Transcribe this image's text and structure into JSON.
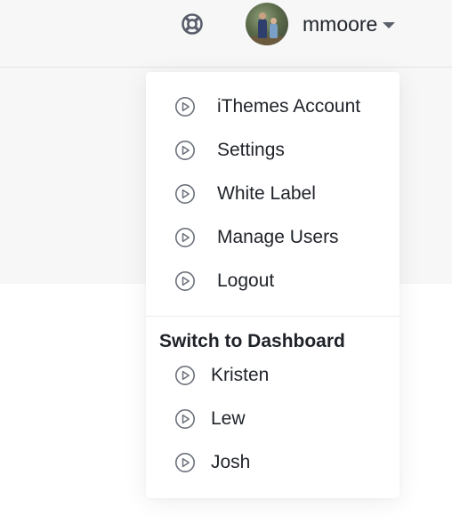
{
  "header": {
    "help_icon": "lifebuoy-icon",
    "user": {
      "username": "mmoore",
      "avatar": "user-avatar-photo",
      "caret_icon": "caret-down-icon"
    }
  },
  "menu": {
    "account_items": [
      {
        "label": "iThemes Account",
        "icon": "play-circle-icon"
      },
      {
        "label": "Settings",
        "icon": "play-circle-icon"
      },
      {
        "label": "White Label",
        "icon": "play-circle-icon"
      },
      {
        "label": "Manage Users",
        "icon": "play-circle-icon"
      },
      {
        "label": "Logout",
        "icon": "play-circle-icon"
      }
    ],
    "dashboard_section": {
      "title": "Switch to Dashboard",
      "items": [
        {
          "label": "Kristen",
          "icon": "play-circle-icon"
        },
        {
          "label": "Lew",
          "icon": "play-circle-icon"
        },
        {
          "label": "Josh",
          "icon": "play-circle-icon"
        }
      ]
    }
  },
  "colors": {
    "text": "#1f2329",
    "icon": "#6b707a",
    "background_panel": "#f7f7f8",
    "menu_background": "#ffffff"
  }
}
